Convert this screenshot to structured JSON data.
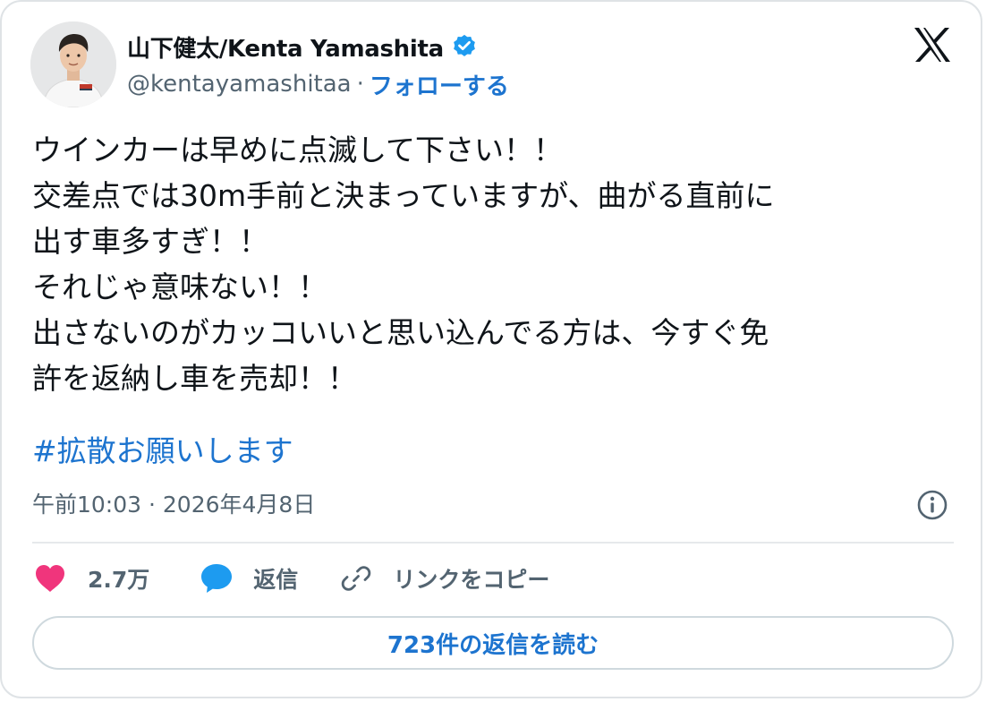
{
  "author": {
    "display_name": "山下健太/Kenta Yamashita",
    "handle": "@kentayamashitaa",
    "separator": "·",
    "follow_label": "フォローする",
    "verified_color": "#1d9bf0"
  },
  "tweet": {
    "lines": [
      "ウインカーは早めに点滅して下さい！！",
      "交差点では30m手前と決まっていますが、曲がる直前に",
      "出す車多すぎ！！",
      "それじゃ意味ない！！",
      "出さないのがカッコいいと思い込んでる方は、今すぐ免",
      "許を返納し車を売却！！"
    ],
    "hashtag": "#拡散お願いします",
    "timestamp": "午前10:03 · 2026年4月8日"
  },
  "actions": {
    "like_count": "2.7万",
    "reply_label": "返信",
    "copy_link_label": "リンクをコピー"
  },
  "read_replies_label": "723件の返信を読む",
  "colors": {
    "accent": "#1d74cf",
    "like": "#f0357c",
    "reply_bubble": "#1d9bf0",
    "secondary_text": "#536471"
  }
}
